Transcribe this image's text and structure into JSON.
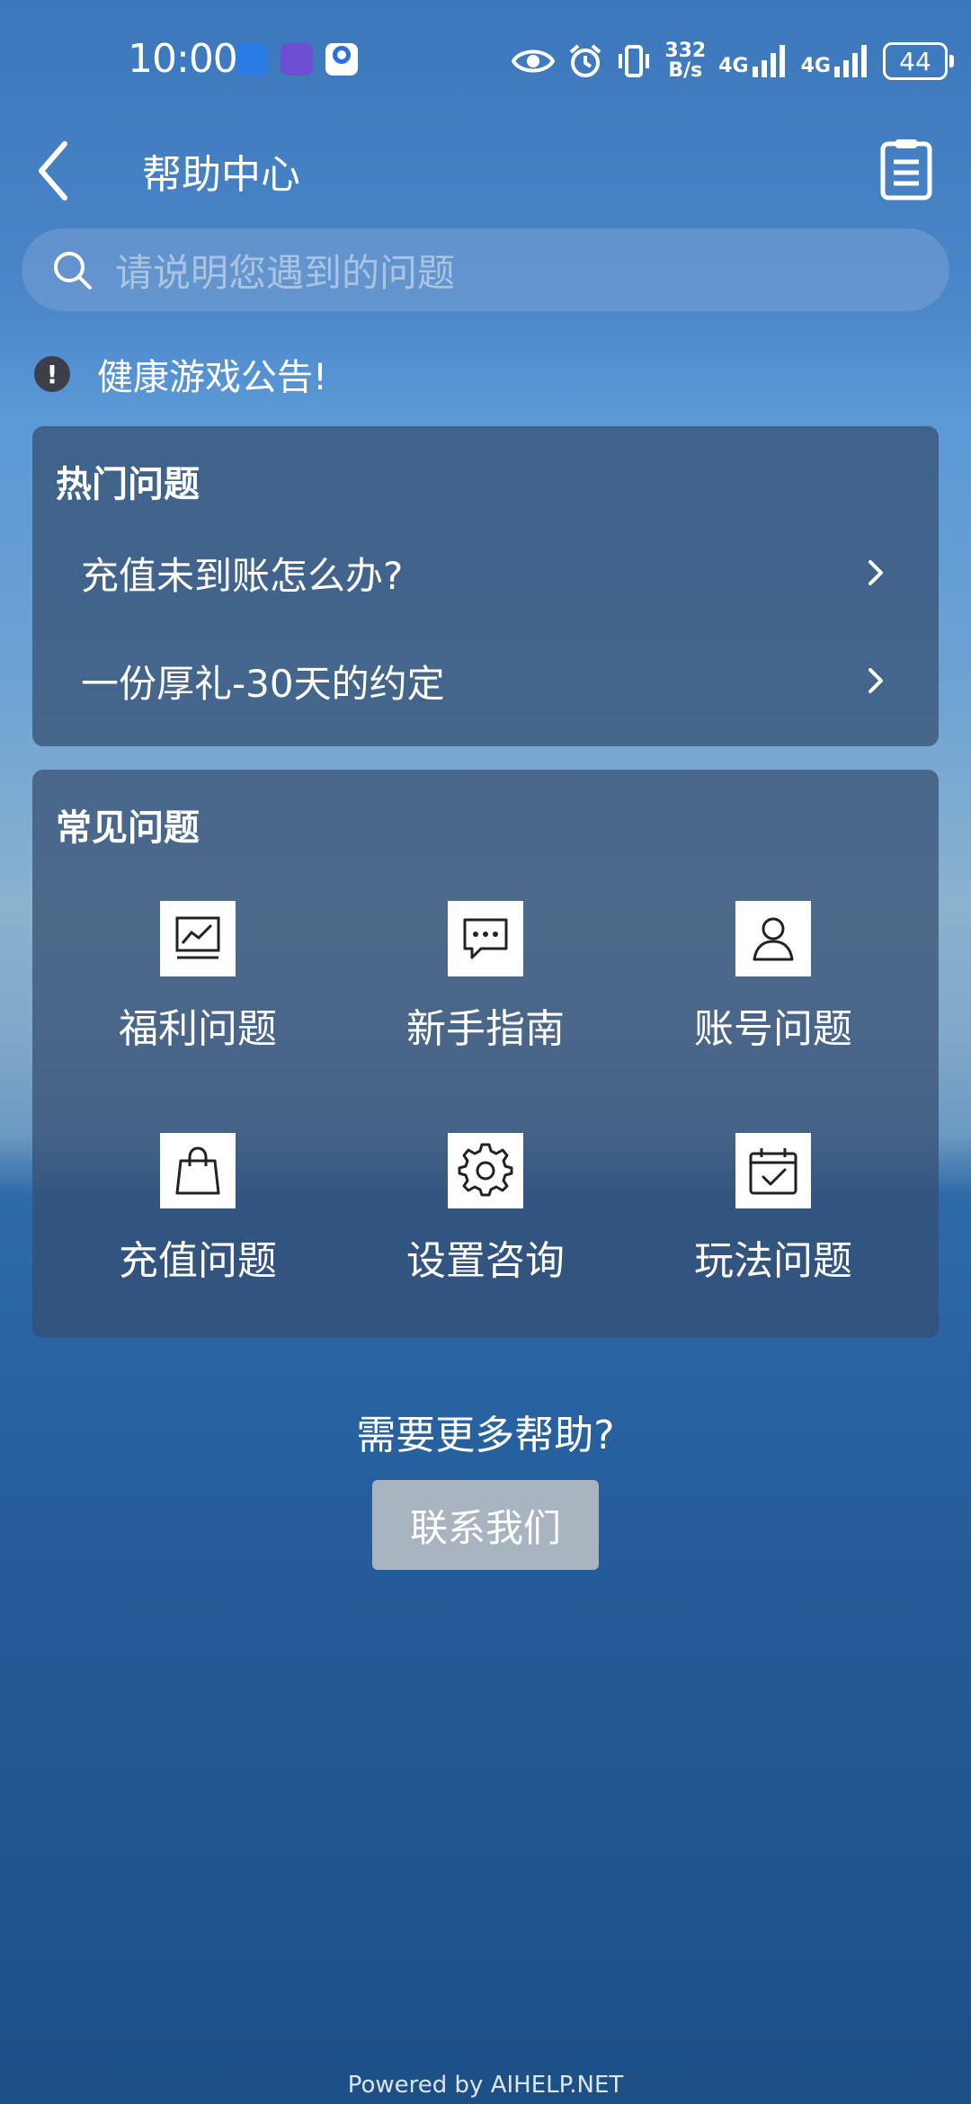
{
  "status_bar": {
    "time": "10:00",
    "net_speed_value": "332",
    "net_speed_unit": "B/s",
    "signal_1": "4G",
    "signal_2": "4G",
    "battery": "44"
  },
  "header": {
    "title": "帮助中心"
  },
  "search": {
    "placeholder": "请说明您遇到的问题"
  },
  "notice": {
    "icon": "!",
    "text": "健康游戏公告!"
  },
  "hot_questions": {
    "title": "热门问题",
    "items": [
      {
        "label": "充值未到账怎么办?"
      },
      {
        "label": "一份厚礼-30天的约定"
      }
    ]
  },
  "faq": {
    "title": "常见问题",
    "items": [
      {
        "label": "福利问题",
        "icon": "chart-icon"
      },
      {
        "label": "新手指南",
        "icon": "message-icon"
      },
      {
        "label": "账号问题",
        "icon": "user-icon"
      },
      {
        "label": "充值问题",
        "icon": "shopping-bag-icon"
      },
      {
        "label": "设置咨询",
        "icon": "gear-icon"
      },
      {
        "label": "玩法问题",
        "icon": "calendar-check-icon"
      }
    ]
  },
  "help": {
    "question": "需要更多帮助?",
    "contact_button": "联系我们"
  },
  "footer": {
    "powered_by": "Powered by AIHELP.NET"
  }
}
